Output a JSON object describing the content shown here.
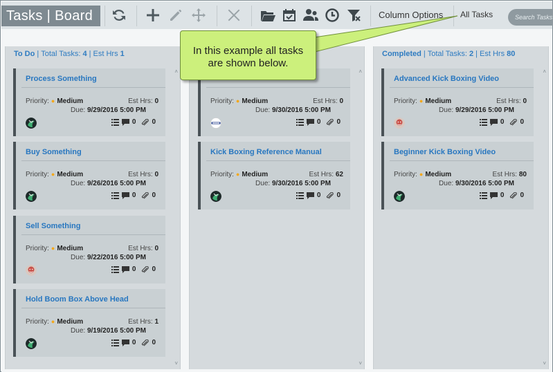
{
  "toolbar": {
    "title_left": "Tasks",
    "title_sep": "|",
    "title_right": "Board",
    "column_options_label": "Column Options",
    "all_tasks_label": "All Tasks",
    "search_placeholder": "Search Tasks",
    "icons": [
      "refresh-icon",
      "add-icon",
      "edit-icon",
      "move-icon",
      "delete-icon",
      "folder-icon",
      "calendar-icon",
      "users-icon",
      "clock-icon",
      "filter-clear-icon"
    ]
  },
  "callout": {
    "text_line1": "In this example all tasks",
    "text_line2": "are shown below."
  },
  "columns": [
    {
      "name": "To Do",
      "total_label": "Total Tasks:",
      "total_value": "4",
      "est_label": "Est Hrs",
      "est_value": "1",
      "cards": [
        {
          "title": "Process Something",
          "priority_label": "Priority:",
          "priority": "Medium",
          "est_label": "Est Hrs:",
          "est": "0",
          "due_label": "Due:",
          "due": "9/29/2016 5:00 PM",
          "comments": "0",
          "attachments": "0",
          "avatar": "green-avatar"
        },
        {
          "title": "Buy Something",
          "priority_label": "Priority:",
          "priority": "Medium",
          "est_label": "Est Hrs:",
          "est": "0",
          "due_label": "Due:",
          "due": "9/26/2016 5:00 PM",
          "comments": "0",
          "attachments": "0",
          "avatar": "green-avatar"
        },
        {
          "title": "Sell Something",
          "priority_label": "Priority:",
          "priority": "Medium",
          "est_label": "Est Hrs:",
          "est": "0",
          "due_label": "Due:",
          "due": "9/22/2016 5:00 PM",
          "comments": "0",
          "attachments": "0",
          "avatar": "face-avatar"
        },
        {
          "title": "Hold Boom Box Above Head",
          "priority_label": "Priority:",
          "priority": "Medium",
          "est_label": "Est Hrs:",
          "est": "1",
          "due_label": "Due:",
          "due": "9/19/2016 5:00 PM",
          "comments": "0",
          "attachments": "0",
          "avatar": "green-avatar"
        }
      ]
    },
    {
      "cards": [
        {
          "title": "",
          "priority_label": "Priority:",
          "priority": "Medium",
          "est_label": "Est Hrs:",
          "est": "0",
          "due_label": "Due:",
          "due": "9/30/2016 5:00 PM",
          "comments": "0",
          "attachments": "0",
          "avatar": "logo-avatar"
        },
        {
          "title": "Kick Boxing Reference Manual",
          "priority_label": "Priority:",
          "priority": "Medium",
          "est_label": "Est Hrs:",
          "est": "62",
          "due_label": "Due:",
          "due": "9/30/2016 5:00 PM",
          "comments": "0",
          "attachments": "0",
          "avatar": "green-avatar"
        }
      ]
    },
    {
      "name": "Completed",
      "total_label": "Total Tasks:",
      "total_value": "2",
      "est_label": "Est Hrs",
      "est_value": "80",
      "cards": [
        {
          "title": "Advanced Kick Boxing Video",
          "priority_label": "Priority:",
          "priority": "Medium",
          "est_label": "Est Hrs:",
          "est": "0",
          "due_label": "Due:",
          "due": "9/29/2016 5:00 PM",
          "comments": "0",
          "attachments": "0",
          "avatar": "face-avatar"
        },
        {
          "title": "Beginner Kick Boxing Video",
          "priority_label": "Priority:",
          "priority": "Medium",
          "est_label": "Est Hrs:",
          "est": "80",
          "due_label": "Due:",
          "due": "9/30/2016 5:00 PM",
          "comments": "0",
          "attachments": "0",
          "avatar": "green-avatar"
        }
      ]
    }
  ],
  "colors": {
    "accent": "#2877c0",
    "priority_dot": "#f2a81d",
    "callout": "#ccf07c"
  }
}
